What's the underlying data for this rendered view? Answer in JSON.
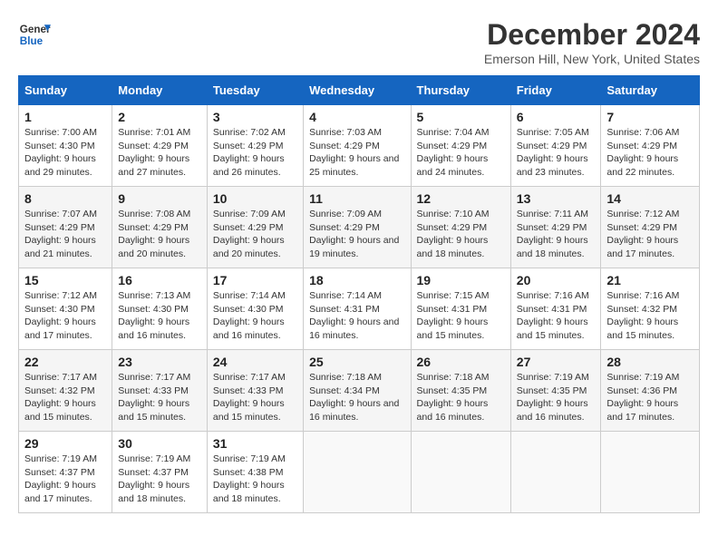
{
  "logo": {
    "line1": "General",
    "line2": "Blue"
  },
  "title": "December 2024",
  "location": "Emerson Hill, New York, United States",
  "days_of_week": [
    "Sunday",
    "Monday",
    "Tuesday",
    "Wednesday",
    "Thursday",
    "Friday",
    "Saturday"
  ],
  "weeks": [
    [
      {
        "day": "1",
        "sunrise": "7:00 AM",
        "sunset": "4:30 PM",
        "daylight": "9 hours and 29 minutes."
      },
      {
        "day": "2",
        "sunrise": "7:01 AM",
        "sunset": "4:29 PM",
        "daylight": "9 hours and 27 minutes."
      },
      {
        "day": "3",
        "sunrise": "7:02 AM",
        "sunset": "4:29 PM",
        "daylight": "9 hours and 26 minutes."
      },
      {
        "day": "4",
        "sunrise": "7:03 AM",
        "sunset": "4:29 PM",
        "daylight": "9 hours and 25 minutes."
      },
      {
        "day": "5",
        "sunrise": "7:04 AM",
        "sunset": "4:29 PM",
        "daylight": "9 hours and 24 minutes."
      },
      {
        "day": "6",
        "sunrise": "7:05 AM",
        "sunset": "4:29 PM",
        "daylight": "9 hours and 23 minutes."
      },
      {
        "day": "7",
        "sunrise": "7:06 AM",
        "sunset": "4:29 PM",
        "daylight": "9 hours and 22 minutes."
      }
    ],
    [
      {
        "day": "8",
        "sunrise": "7:07 AM",
        "sunset": "4:29 PM",
        "daylight": "9 hours and 21 minutes."
      },
      {
        "day": "9",
        "sunrise": "7:08 AM",
        "sunset": "4:29 PM",
        "daylight": "9 hours and 20 minutes."
      },
      {
        "day": "10",
        "sunrise": "7:09 AM",
        "sunset": "4:29 PM",
        "daylight": "9 hours and 20 minutes."
      },
      {
        "day": "11",
        "sunrise": "7:09 AM",
        "sunset": "4:29 PM",
        "daylight": "9 hours and 19 minutes."
      },
      {
        "day": "12",
        "sunrise": "7:10 AM",
        "sunset": "4:29 PM",
        "daylight": "9 hours and 18 minutes."
      },
      {
        "day": "13",
        "sunrise": "7:11 AM",
        "sunset": "4:29 PM",
        "daylight": "9 hours and 18 minutes."
      },
      {
        "day": "14",
        "sunrise": "7:12 AM",
        "sunset": "4:29 PM",
        "daylight": "9 hours and 17 minutes."
      }
    ],
    [
      {
        "day": "15",
        "sunrise": "7:12 AM",
        "sunset": "4:30 PM",
        "daylight": "9 hours and 17 minutes."
      },
      {
        "day": "16",
        "sunrise": "7:13 AM",
        "sunset": "4:30 PM",
        "daylight": "9 hours and 16 minutes."
      },
      {
        "day": "17",
        "sunrise": "7:14 AM",
        "sunset": "4:30 PM",
        "daylight": "9 hours and 16 minutes."
      },
      {
        "day": "18",
        "sunrise": "7:14 AM",
        "sunset": "4:31 PM",
        "daylight": "9 hours and 16 minutes."
      },
      {
        "day": "19",
        "sunrise": "7:15 AM",
        "sunset": "4:31 PM",
        "daylight": "9 hours and 15 minutes."
      },
      {
        "day": "20",
        "sunrise": "7:16 AM",
        "sunset": "4:31 PM",
        "daylight": "9 hours and 15 minutes."
      },
      {
        "day": "21",
        "sunrise": "7:16 AM",
        "sunset": "4:32 PM",
        "daylight": "9 hours and 15 minutes."
      }
    ],
    [
      {
        "day": "22",
        "sunrise": "7:17 AM",
        "sunset": "4:32 PM",
        "daylight": "9 hours and 15 minutes."
      },
      {
        "day": "23",
        "sunrise": "7:17 AM",
        "sunset": "4:33 PM",
        "daylight": "9 hours and 15 minutes."
      },
      {
        "day": "24",
        "sunrise": "7:17 AM",
        "sunset": "4:33 PM",
        "daylight": "9 hours and 15 minutes."
      },
      {
        "day": "25",
        "sunrise": "7:18 AM",
        "sunset": "4:34 PM",
        "daylight": "9 hours and 16 minutes."
      },
      {
        "day": "26",
        "sunrise": "7:18 AM",
        "sunset": "4:35 PM",
        "daylight": "9 hours and 16 minutes."
      },
      {
        "day": "27",
        "sunrise": "7:19 AM",
        "sunset": "4:35 PM",
        "daylight": "9 hours and 16 minutes."
      },
      {
        "day": "28",
        "sunrise": "7:19 AM",
        "sunset": "4:36 PM",
        "daylight": "9 hours and 17 minutes."
      }
    ],
    [
      {
        "day": "29",
        "sunrise": "7:19 AM",
        "sunset": "4:37 PM",
        "daylight": "9 hours and 17 minutes."
      },
      {
        "day": "30",
        "sunrise": "7:19 AM",
        "sunset": "4:37 PM",
        "daylight": "9 hours and 18 minutes."
      },
      {
        "day": "31",
        "sunrise": "7:19 AM",
        "sunset": "4:38 PM",
        "daylight": "9 hours and 18 minutes."
      },
      null,
      null,
      null,
      null
    ]
  ],
  "labels": {
    "sunrise": "Sunrise:",
    "sunset": "Sunset:",
    "daylight": "Daylight:"
  }
}
